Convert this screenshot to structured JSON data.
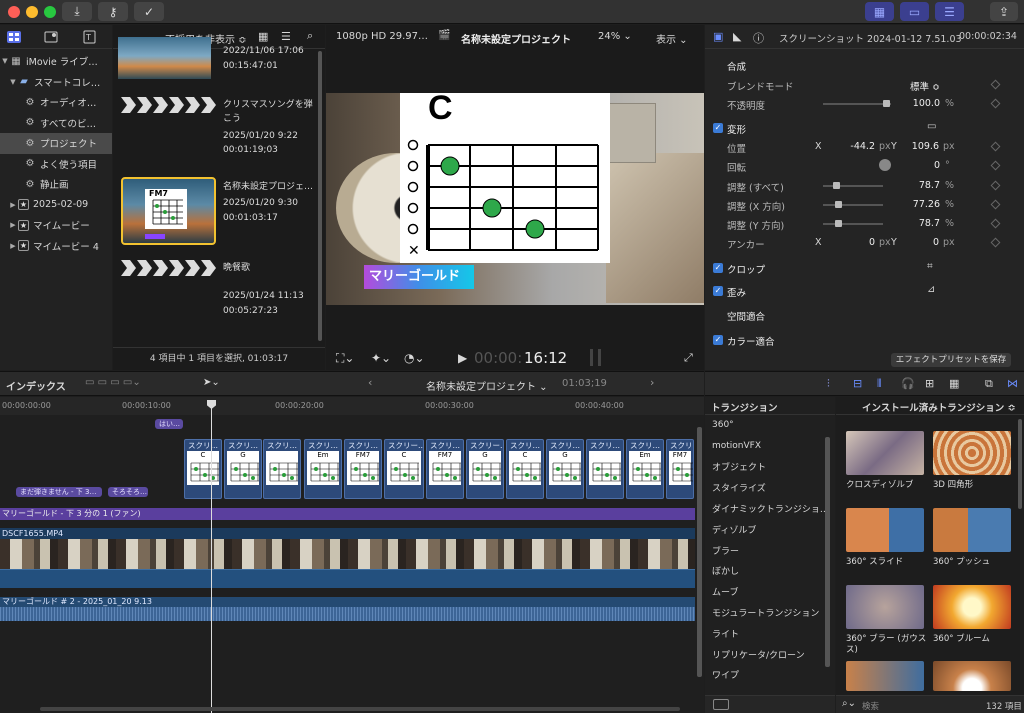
{
  "toolbar": {
    "import_icon": "download-arrow-icon",
    "keyword_icon": "key-icon",
    "check_icon": "check-circle-icon",
    "share_icon": "share-icon"
  },
  "library": {
    "items": [
      {
        "label": "iMovie ライブ…",
        "level": 0,
        "icon": "library-grid-icon"
      },
      {
        "label": "スマートコレ…",
        "level": 1,
        "icon": "folder-icon"
      },
      {
        "label": "オーディオ…",
        "level": 2,
        "icon": "gear-icon"
      },
      {
        "label": "すべてのビ…",
        "level": 2,
        "icon": "gear-icon"
      },
      {
        "label": "プロジェクト",
        "level": 2,
        "icon": "gear-icon",
        "selected": true
      },
      {
        "label": "よく使う項目",
        "level": 2,
        "icon": "gear-icon"
      },
      {
        "label": "静止画",
        "level": 2,
        "icon": "gear-icon"
      },
      {
        "label": "2025-02-09",
        "level": 1,
        "icon": "star-event-icon"
      },
      {
        "label": "マイムービー",
        "level": 1,
        "icon": "star-event-icon"
      },
      {
        "label": "マイムービー 4",
        "level": 1,
        "icon": "star-event-icon"
      }
    ]
  },
  "browser": {
    "filter": "不採用を非表示 ≎",
    "clips": [
      {
        "title": "",
        "date": "2022/11/06 17:06",
        "duration": "00:15:47:01"
      },
      {
        "title": "クリスマスソングを弾",
        "title2": "こう",
        "date": "2025/01/20 9:22",
        "duration": "00:01:19;03"
      },
      {
        "title": "名称未設定プロジェ…",
        "date": "2025/01/20 9:30",
        "duration": "00:01:03:17",
        "thumb_label": "FM7"
      },
      {
        "title": "晩餐歌",
        "date": "2025/01/24 11:13",
        "duration": "00:05:27:23"
      }
    ],
    "status": "4 項目中 1 項目を選択, 01:03:17"
  },
  "viewer": {
    "format": "1080p HD 29.97…",
    "project": "名称未設定プロジェクト",
    "zoom": "24% ⌄",
    "view": "表示 ⌄",
    "chord": "C",
    "title_overlay": "マリーゴールド",
    "timecode_dim": "00:00:",
    "timecode": "16:12"
  },
  "inspector": {
    "title": "スクリーンショット 2024-01-12 7.51.03",
    "time": "00:00:02:34",
    "rows": [
      {
        "label": "合成",
        "section": true
      },
      {
        "label": "ブレンドモード",
        "value": "標準 ≎"
      },
      {
        "label": "不透明度",
        "value": "100.0",
        "unit": "%"
      },
      {
        "label": "変形",
        "section": true,
        "checked": true
      },
      {
        "label": "位置",
        "x": "-44.2",
        "y": "109.6",
        "unit": "px"
      },
      {
        "label": "回転",
        "value": "0",
        "unit": "°"
      },
      {
        "label": "調整 (すべて)",
        "value": "78.7",
        "unit": "%"
      },
      {
        "label": "調整 (X 方向)",
        "value": "77.26",
        "unit": "%"
      },
      {
        "label": "調整 (Y 方向)",
        "value": "78.7",
        "unit": "%"
      },
      {
        "label": "アンカー",
        "x": "0",
        "y": "0",
        "unit": "px"
      },
      {
        "label": "クロップ",
        "section": true,
        "checked": true
      },
      {
        "label": "歪み",
        "section": true,
        "checked": true
      },
      {
        "label": "空間適合",
        "section": true
      },
      {
        "label": "カラー適合",
        "section": true,
        "checked": true
      }
    ],
    "x_label": "X",
    "y_label": "Y",
    "save_preset": "エフェクトプリセットを保存"
  },
  "timeline": {
    "index": "インデックス",
    "project": "名称未設定プロジェクト ⌄",
    "duration": "01:03;19",
    "ruler": [
      "00:00:00:00",
      "00:00:10:00",
      "00:00:20:00",
      "00:00:30:00",
      "00:00:40:00"
    ],
    "connected": [
      {
        "label": "はい…"
      },
      {
        "label": "まだ弾きません - 下 3…"
      },
      {
        "label": "そろそろ…"
      }
    ],
    "clips": [
      {
        "label": "スクリ…",
        "chord": "C"
      },
      {
        "label": "スクリ…",
        "chord": "G"
      },
      {
        "label": "スクリ…",
        "chord": ""
      },
      {
        "label": "スクリ…",
        "chord": "Em"
      },
      {
        "label": "スクリ…",
        "chord": "FM7"
      },
      {
        "label": "スクリー…",
        "chord": "C"
      },
      {
        "label": "スクリ…",
        "chord": "FM7"
      },
      {
        "label": "スクリー…",
        "chord": "G"
      },
      {
        "label": "スクリ…",
        "chord": "C"
      },
      {
        "label": "スクリ…",
        "chord": "G"
      },
      {
        "label": "スクリ…",
        "chord": ""
      },
      {
        "label": "スクリ…",
        "chord": "Em"
      },
      {
        "label": "スクリ…",
        "chord": "FM7"
      }
    ],
    "title_track": "マリーゴールド - 下 3 分の 1 (ファン)",
    "video_track": "DSCF1655.MP4",
    "audio_track": "マリーゴールド # 2 - 2025_01_20 9.13"
  },
  "transitions": {
    "header": "トランジション",
    "categories": [
      "360°",
      "motionVFX",
      "オブジェクト",
      "スタイライズ",
      "ダイナミックトランジショ…",
      "ディゾルブ",
      "ブラー",
      "ぼかし",
      "ムーブ",
      "モジュラートランジション",
      "ライト",
      "リプリケータ/クローン",
      "ワイプ"
    ],
    "grid_header": "インストール済みトランジション ≎",
    "tiles": [
      {
        "label": "クロスディゾルブ"
      },
      {
        "label": "3D 四角形"
      },
      {
        "label": "360° スライド"
      },
      {
        "label": "360° プッシュ"
      },
      {
        "label": "360° ブラー (ガウス"
      },
      {
        "label": "360° ブルーム"
      }
    ],
    "tile_label_wrap": "ス)",
    "search_placeholder": "検索",
    "count": "132 項目"
  }
}
